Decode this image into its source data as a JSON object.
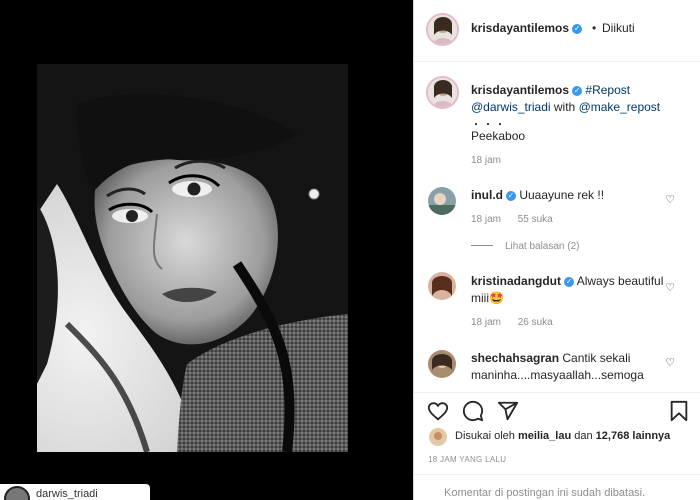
{
  "post": {
    "username": "krisdayantilemos",
    "follow_status": "Diikuti",
    "separator": "•",
    "caption": {
      "hashtag": "#Repost",
      "mention1": "@darwis_triadi",
      "with_word": "with",
      "mention2": "@make_repost",
      "dots": "・・・",
      "text": "Peekaboo",
      "time": "18 jam"
    },
    "comments": [
      {
        "username": "inul.d",
        "text": "Uuaayune rek !!",
        "time": "18 jam",
        "likes": "55 suka",
        "replies": "Lihat balasan (2)"
      },
      {
        "username": "kristinadangdut",
        "text": "Always beautiful miii🤩",
        "time": "18 jam",
        "likes": "26 suka"
      },
      {
        "username": "shechahsagran",
        "text": "Cantik sekali maninha....masyaallah...semoga"
      }
    ],
    "likes_text_prefix": "Disukai oleh",
    "likes_user": "meilia_lau",
    "likes_text_mid": "dan",
    "likes_count": "12,768",
    "likes_text_suffix": "lainnya",
    "posted_ago": "18 JAM YANG LALU",
    "comments_disabled": "Komentar di postingan ini sudah dibatasi."
  },
  "bottom_bar": {
    "text": "darwis_triadi"
  },
  "colors": {
    "link": "#00376b",
    "verified": "#3897f0",
    "muted": "#8e8e8e",
    "text": "#262626"
  },
  "icons": [
    "verified-badge-icon",
    "heart-icon",
    "comment-icon",
    "share-icon",
    "bookmark-icon"
  ]
}
